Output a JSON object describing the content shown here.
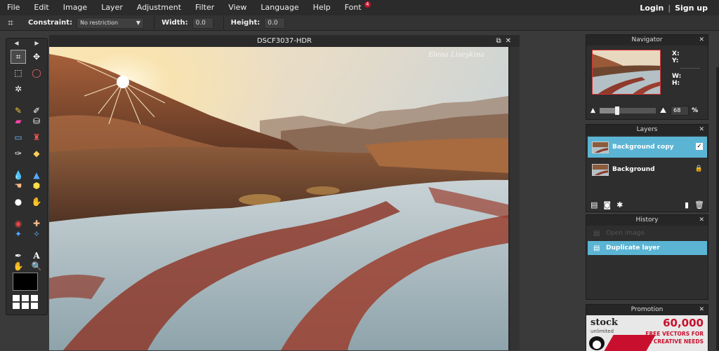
{
  "menu": {
    "items": [
      "File",
      "Edit",
      "Image",
      "Layer",
      "Adjustment",
      "Filter",
      "View",
      "Language",
      "Help",
      "Font"
    ],
    "font_badge": "4",
    "login": "Login",
    "separator": "|",
    "signup": "Sign up"
  },
  "options": {
    "constraint_label": "Constraint:",
    "constraint_value": "No restriction",
    "width_label": "Width:",
    "width_value": "0.0",
    "height_label": "Height:",
    "height_value": "0.0"
  },
  "document": {
    "title": "DSCF3037-HDR",
    "watermark": "Elena Liseykina"
  },
  "navigator": {
    "title": "Navigator",
    "x_label": "X:",
    "y_label": "Y:",
    "w_label": "W:",
    "h_label": "H:",
    "zoom": "68",
    "zoom_unit": "%"
  },
  "layers": {
    "title": "Layers",
    "items": [
      {
        "name": "Background copy",
        "selected": true
      },
      {
        "name": "Background",
        "locked": true
      }
    ]
  },
  "history": {
    "title": "History",
    "items": [
      {
        "name": "Open image"
      },
      {
        "name": "Duplicate layer",
        "selected": true
      }
    ]
  },
  "promotion": {
    "title": "Promotion",
    "brand": "stock",
    "brand_sub": "unlimited",
    "headline": "60,000",
    "line1": "FREE VECTORS FOR",
    "line2": "YOUR CREATIVE NEEDS"
  },
  "colors": {
    "accent": "#5bb4d4",
    "badge": "#c8102e",
    "foreground_swatch": "#000000"
  },
  "icons": {
    "close": "close-icon",
    "crop": "crop-icon"
  }
}
